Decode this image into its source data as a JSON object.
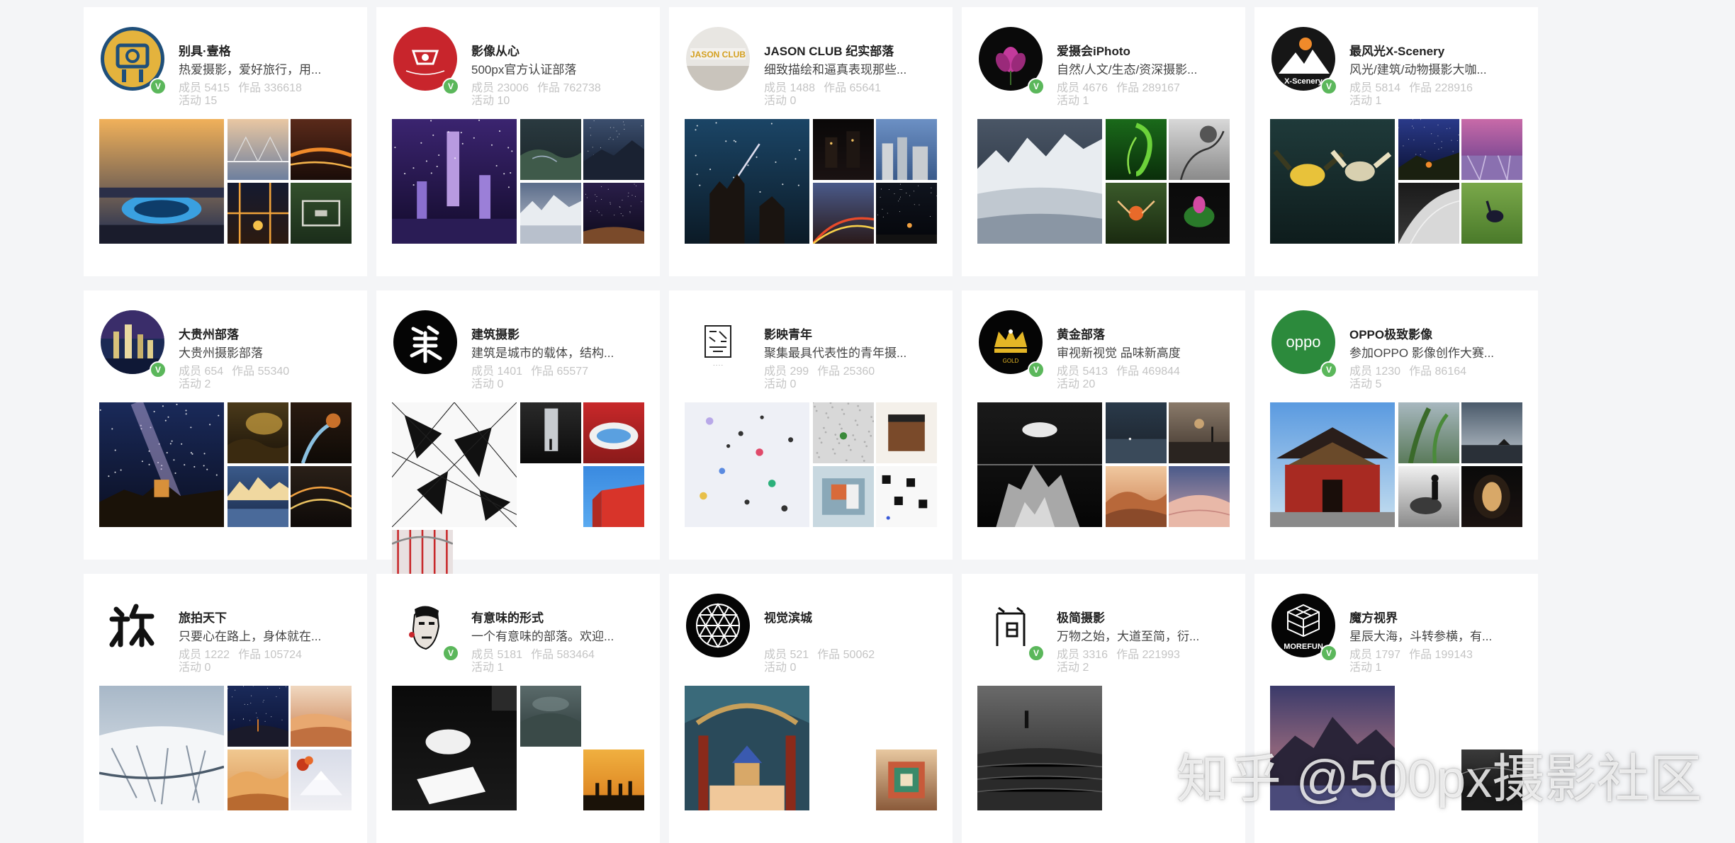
{
  "labels": {
    "members": "成员",
    "works": "作品",
    "activity": "活动"
  },
  "watermark": "知乎 @500px摄影社区",
  "groups": [
    {
      "name": "别具·壹格",
      "desc": "热爱摄影，爱好旅行，用...",
      "members": "5415",
      "works": "336618",
      "activity": "15",
      "avatar": "camera-logo-avatar",
      "verified": true
    },
    {
      "name": "影像从心",
      "desc": "500px官方认证部落",
      "members": "23006",
      "works": "762738",
      "activity": "10",
      "avatar": "red-camera-logo-avatar",
      "verified": true
    },
    {
      "name": "JASON CLUB 纪实部落",
      "desc": "细致描绘和逼真表现那些...",
      "members": "1488",
      "works": "65641",
      "activity": "0",
      "avatar": "jason-club-logo-avatar",
      "verified": false
    },
    {
      "name": "爱摄会iPhoto",
      "desc": "自然/人文/生态/资深摄影...",
      "members": "4676",
      "works": "289167",
      "activity": "1",
      "avatar": "lotus-flower-avatar",
      "verified": true
    },
    {
      "name": "最风光X-Scenery",
      "desc": "风光/建筑/动物摄影大咖...",
      "members": "5814",
      "works": "228916",
      "activity": "1",
      "avatar": "x-scenery-logo-avatar",
      "verified": true
    },
    {
      "name": "大贵州部落",
      "desc": "大贵州摄影部落",
      "members": "654",
      "works": "55340",
      "activity": "2",
      "avatar": "city-night-avatar",
      "verified": true
    },
    {
      "name": "建筑摄影",
      "desc": "建筑是城市的载体，结构...",
      "members": "1401",
      "works": "65577",
      "activity": "0",
      "avatar": "calligraphy-avatar",
      "verified": false
    },
    {
      "name": "影映青年",
      "desc": "聚集最具代表性的青年摄...",
      "members": "299",
      "works": "25360",
      "activity": "0",
      "avatar": "seal-logo-avatar",
      "verified": false
    },
    {
      "name": "黄金部落",
      "desc": "审视新视觉 品味新高度",
      "members": "5413",
      "works": "469844",
      "activity": "20",
      "avatar": "crown-logo-avatar",
      "verified": true
    },
    {
      "name": "OPPO极致影像",
      "desc": "参加OPPO 影像创作大赛...",
      "members": "1230",
      "works": "86164",
      "activity": "5",
      "avatar": "oppo-logo-avatar",
      "verified": true
    },
    {
      "name": "旅拍天下",
      "desc": "只要心在路上，身体就在...",
      "members": "1222",
      "works": "105724",
      "activity": "0",
      "avatar": "calligraphy-avatar",
      "verified": false
    },
    {
      "name": "有意味的形式",
      "desc": "一个有意味的部落。欢迎...",
      "members": "5181",
      "works": "583464",
      "activity": "1",
      "avatar": "portrait-sketch-avatar",
      "verified": true
    },
    {
      "name": "视觉滨城",
      "desc": "",
      "members": "521",
      "works": "50062",
      "activity": "0",
      "avatar": "geometric-logo-avatar",
      "verified": false
    },
    {
      "name": "极简摄影",
      "desc": "万物之始，大道至简，衍...",
      "members": "3316",
      "works": "221993",
      "activity": "2",
      "avatar": "minimal-glyph-avatar",
      "verified": true
    },
    {
      "name": "魔方视界",
      "desc": "星辰大海，斗转参横，有...",
      "members": "1797",
      "works": "199143",
      "activity": "1",
      "avatar": "morefun-cube-avatar",
      "verified": true
    }
  ]
}
